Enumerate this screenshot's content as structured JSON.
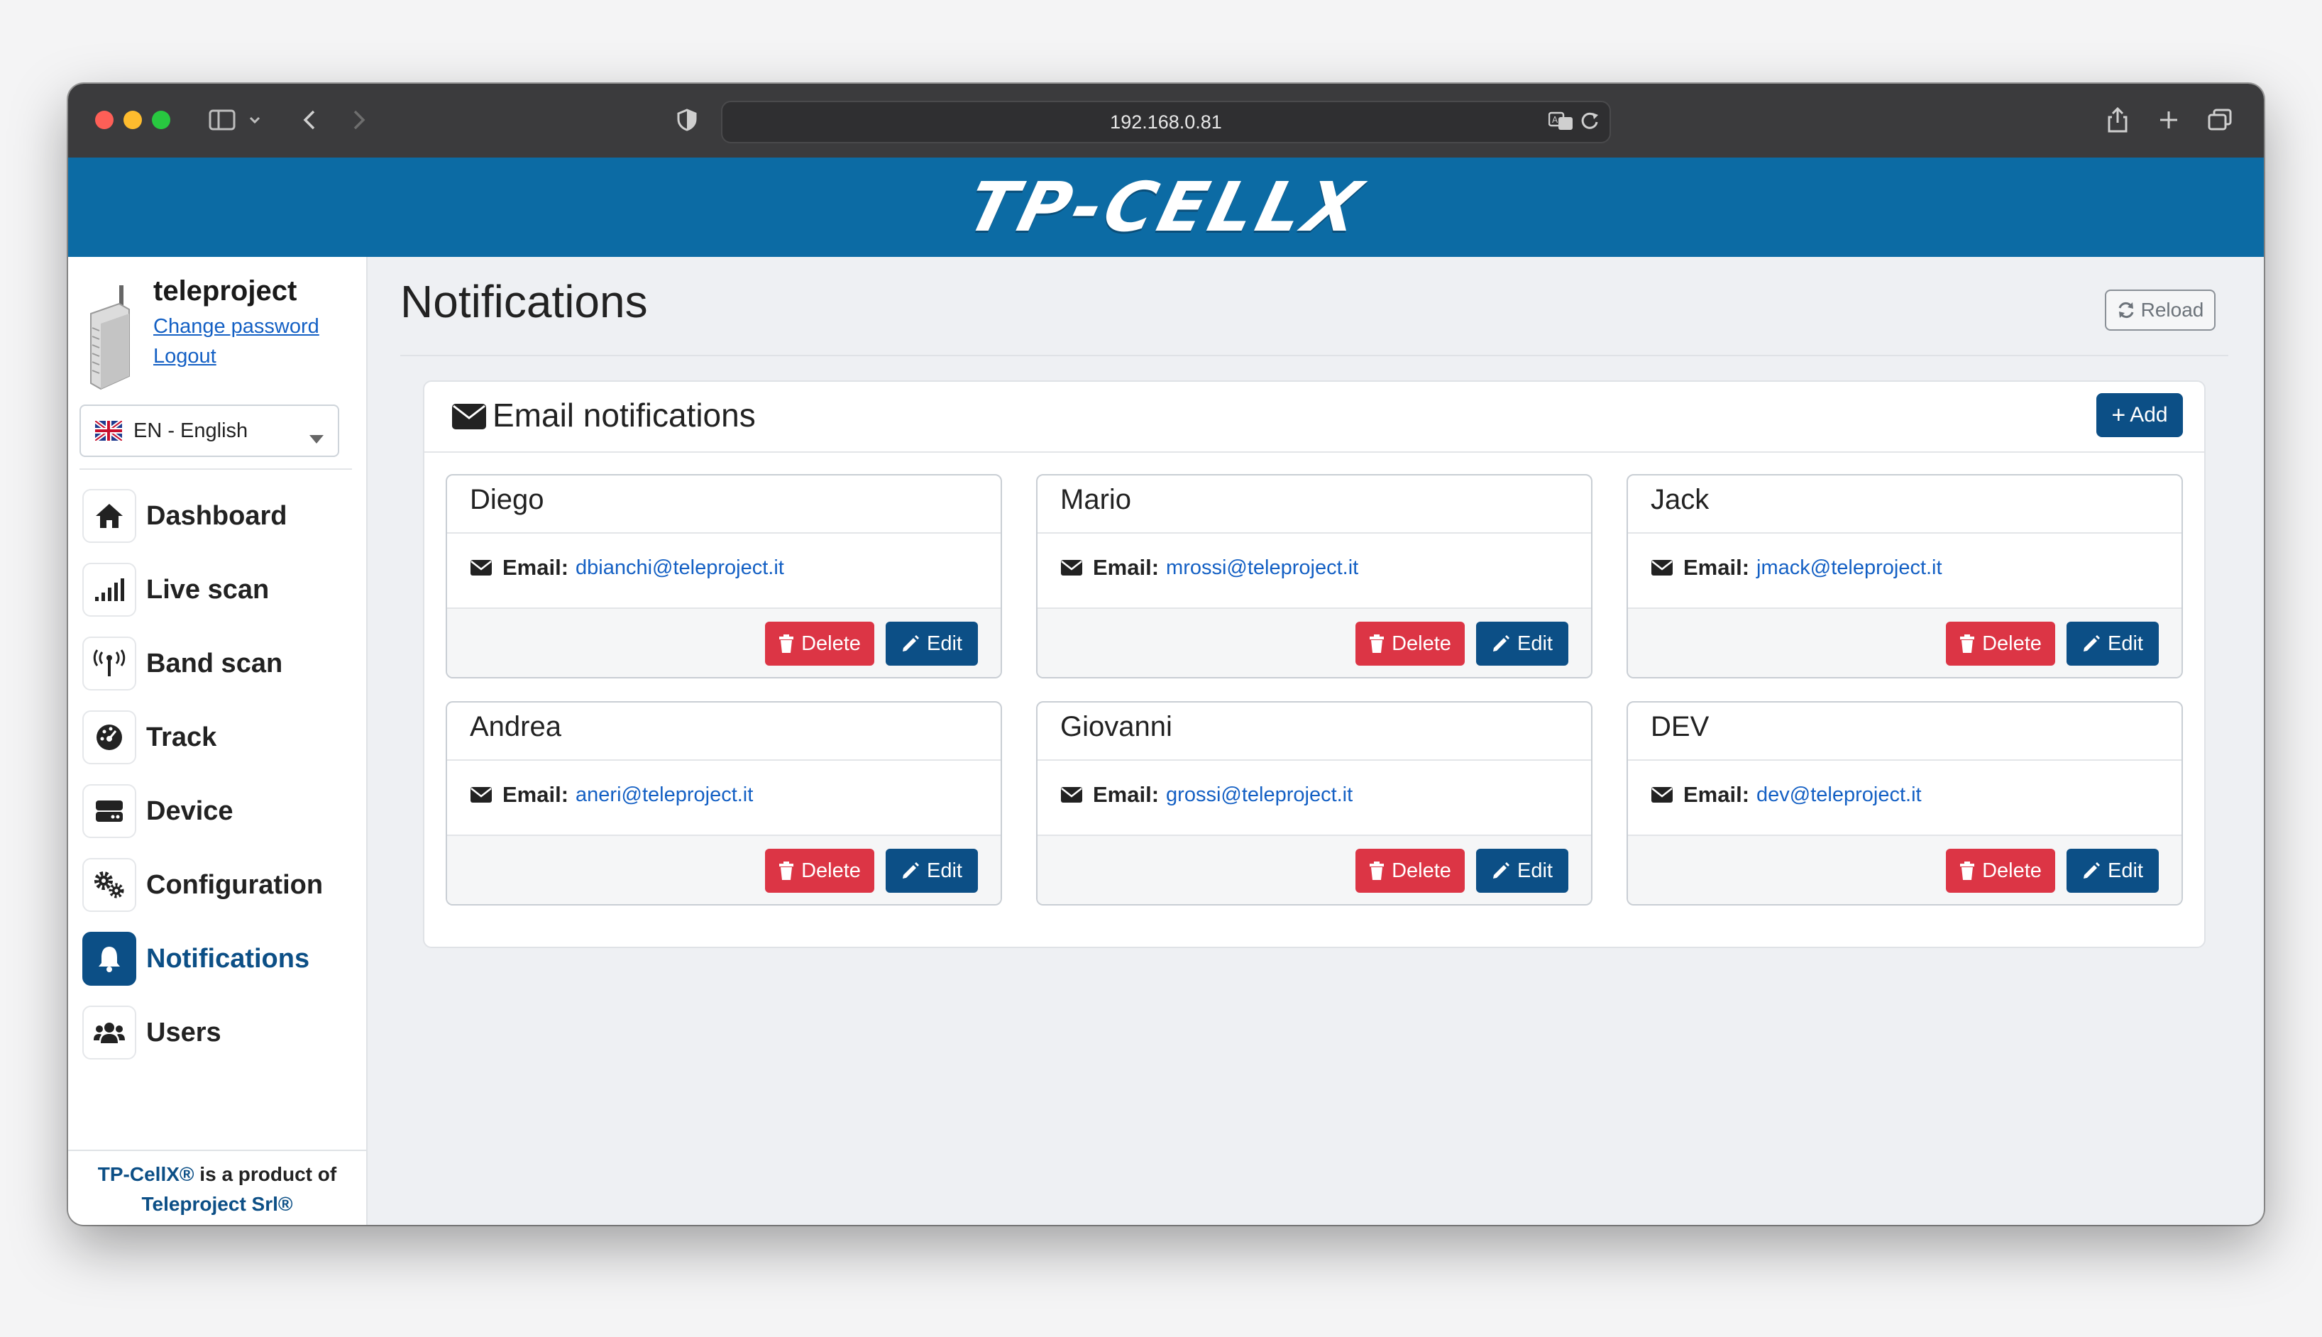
{
  "browser": {
    "url": "192.168.0.81"
  },
  "header": {
    "logo_text": "TP-CELLX"
  },
  "sidebar": {
    "username": "teleproject",
    "change_password": "Change password",
    "logout": "Logout",
    "language": "EN - English",
    "items": [
      {
        "label": "Dashboard",
        "icon": "home-icon"
      },
      {
        "label": "Live scan",
        "icon": "signal-bars-icon"
      },
      {
        "label": "Band scan",
        "icon": "antenna-icon"
      },
      {
        "label": "Track",
        "icon": "gauge-icon"
      },
      {
        "label": "Device",
        "icon": "hard-drive-icon"
      },
      {
        "label": "Configuration",
        "icon": "cogs-icon"
      },
      {
        "label": "Notifications",
        "icon": "bell-icon",
        "active": true
      },
      {
        "label": "Users",
        "icon": "users-icon"
      }
    ],
    "footer_brand": "TP-CellX®",
    "footer_text": " is a product of",
    "footer_company": "Teleproject Srl®"
  },
  "main": {
    "title": "Notifications",
    "reload_label": "Reload",
    "section_title": "Email notifications",
    "add_label": "Add",
    "email_label": "Email:",
    "delete_label": "Delete",
    "edit_label": "Edit",
    "recipients": [
      {
        "name": "Diego",
        "email": "dbianchi@teleproject.it"
      },
      {
        "name": "Mario",
        "email": "mrossi@teleproject.it"
      },
      {
        "name": "Jack",
        "email": "jmack@teleproject.it"
      },
      {
        "name": "Andrea",
        "email": "aneri@teleproject.it"
      },
      {
        "name": "Giovanni",
        "email": "grossi@teleproject.it"
      },
      {
        "name": "DEV",
        "email": "dev@teleproject.it"
      }
    ]
  },
  "colors": {
    "header_blue": "#0c6ba4",
    "primary": "#0c4f86",
    "danger": "#dc3545",
    "link": "#1460c4"
  }
}
